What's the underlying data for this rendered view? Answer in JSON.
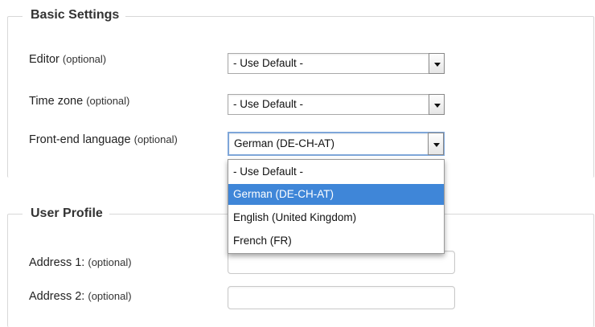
{
  "basic_settings": {
    "legend": "Basic Settings",
    "fields": [
      {
        "label": "Editor",
        "optional": "(optional)",
        "value": "- Use Default -"
      },
      {
        "label": "Time zone",
        "optional": "(optional)",
        "value": "- Use Default -"
      },
      {
        "label": "Front-end language",
        "optional": "(optional)",
        "value": "German (DE-CH-AT)"
      }
    ]
  },
  "language_dropdown": {
    "options": [
      "- Use Default -",
      "German (DE-CH-AT)",
      "English (United Kingdom)",
      "French (FR)"
    ],
    "selected_index": 1,
    "highlight_color": "#3f86d8"
  },
  "user_profile": {
    "legend": "User Profile",
    "fields": [
      {
        "label": "Address 1:",
        "optional": "(optional)",
        "value": ""
      },
      {
        "label": "Address 2:",
        "optional": "(optional)",
        "value": ""
      }
    ]
  }
}
